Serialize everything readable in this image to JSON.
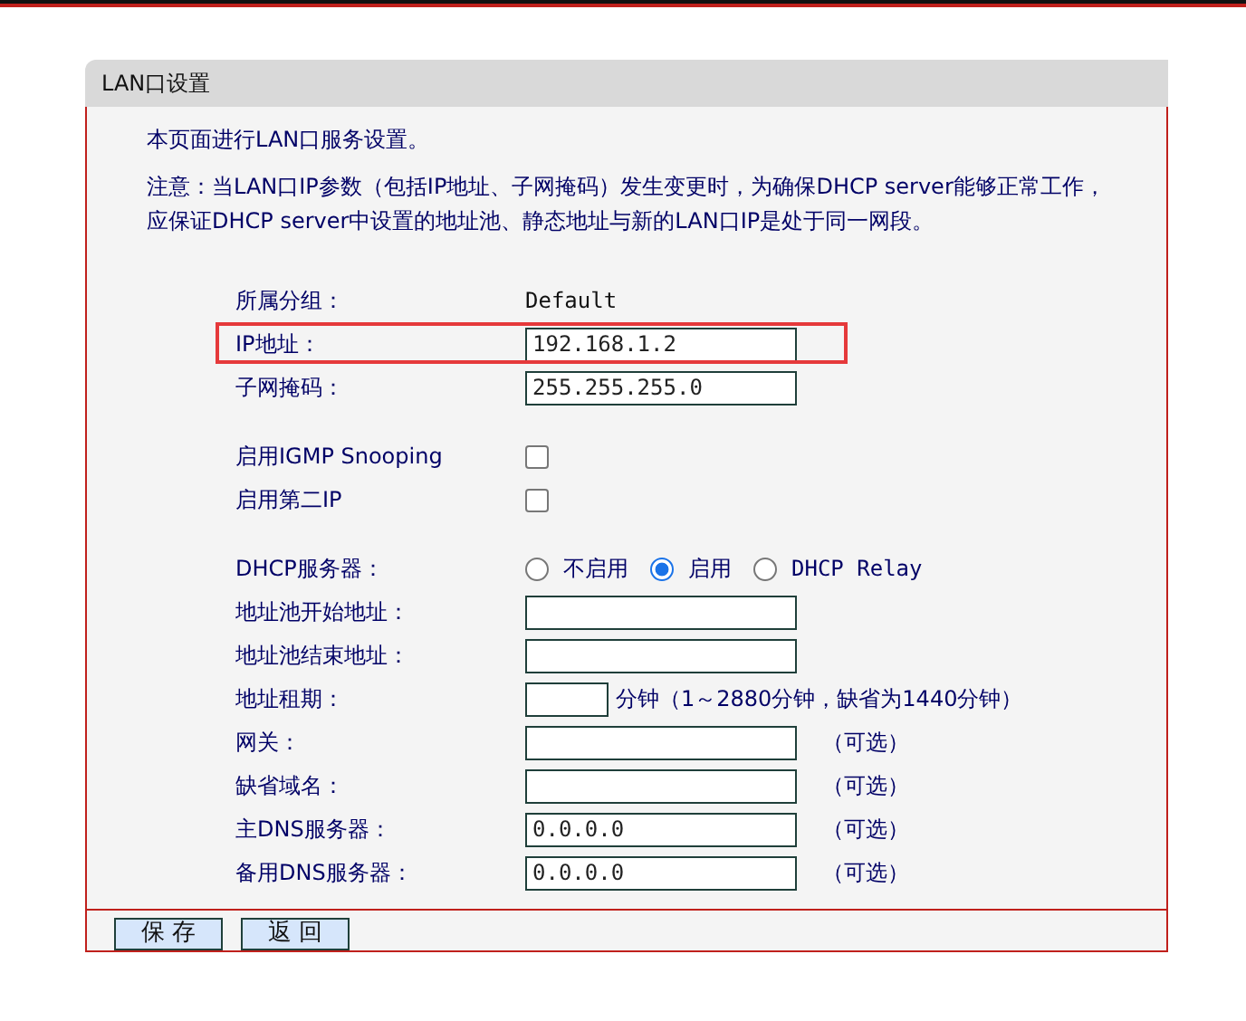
{
  "panel": {
    "title": "LAN口设置"
  },
  "intro": "本页面进行LAN口服务设置。",
  "note": "注意：当LAN口IP参数（包括IP地址、子网掩码）发生变更时，为确保DHCP server能够正常工作，应保证DHCP server中设置的地址池、静态地址与新的LAN口IP是处于同一网段。",
  "rows": [
    {
      "kind": "text",
      "label": "所属分组：",
      "value": "Default"
    },
    {
      "kind": "field",
      "label": "IP地址：",
      "value": "192.168.1.2",
      "highlighted": true
    },
    {
      "kind": "field",
      "label": "子网掩码：",
      "value": "255.255.255.0",
      "highlighted": false
    },
    {
      "kind": "gap"
    },
    {
      "kind": "checkbox",
      "label": "启用IGMP Snooping",
      "checked": false
    },
    {
      "kind": "checkbox",
      "label": "启用第二IP",
      "checked": false
    },
    {
      "kind": "gap"
    },
    {
      "kind": "radio",
      "label": "DHCP服务器：",
      "options": [
        {
          "label": "不启用",
          "selected": false
        },
        {
          "label": "启用",
          "selected": true
        },
        {
          "label": "DHCP Relay",
          "selected": false
        }
      ]
    },
    {
      "kind": "field",
      "label": "地址池开始地址：",
      "highlighted": false
    },
    {
      "kind": "field",
      "label": "地址池结束地址：",
      "highlighted": false
    },
    {
      "kind": "short",
      "label": "地址租期：",
      "suffix": "分钟（1～2880分钟，缺省为1440分钟）"
    },
    {
      "kind": "field",
      "label": "网关：",
      "suffix": "（可选）",
      "highlighted": false
    },
    {
      "kind": "field",
      "label": "缺省域名：",
      "suffix": "（可选）",
      "highlighted": false
    },
    {
      "kind": "field",
      "label": "主DNS服务器：",
      "value": "0.0.0.0",
      "suffix": "（可选）",
      "highlighted": false
    },
    {
      "kind": "field",
      "label": "备用DNS服务器：",
      "value": "0.0.0.0",
      "suffix": "（可选）",
      "highlighted": false
    }
  ],
  "buttons": [
    "保 存",
    "返 回"
  ]
}
